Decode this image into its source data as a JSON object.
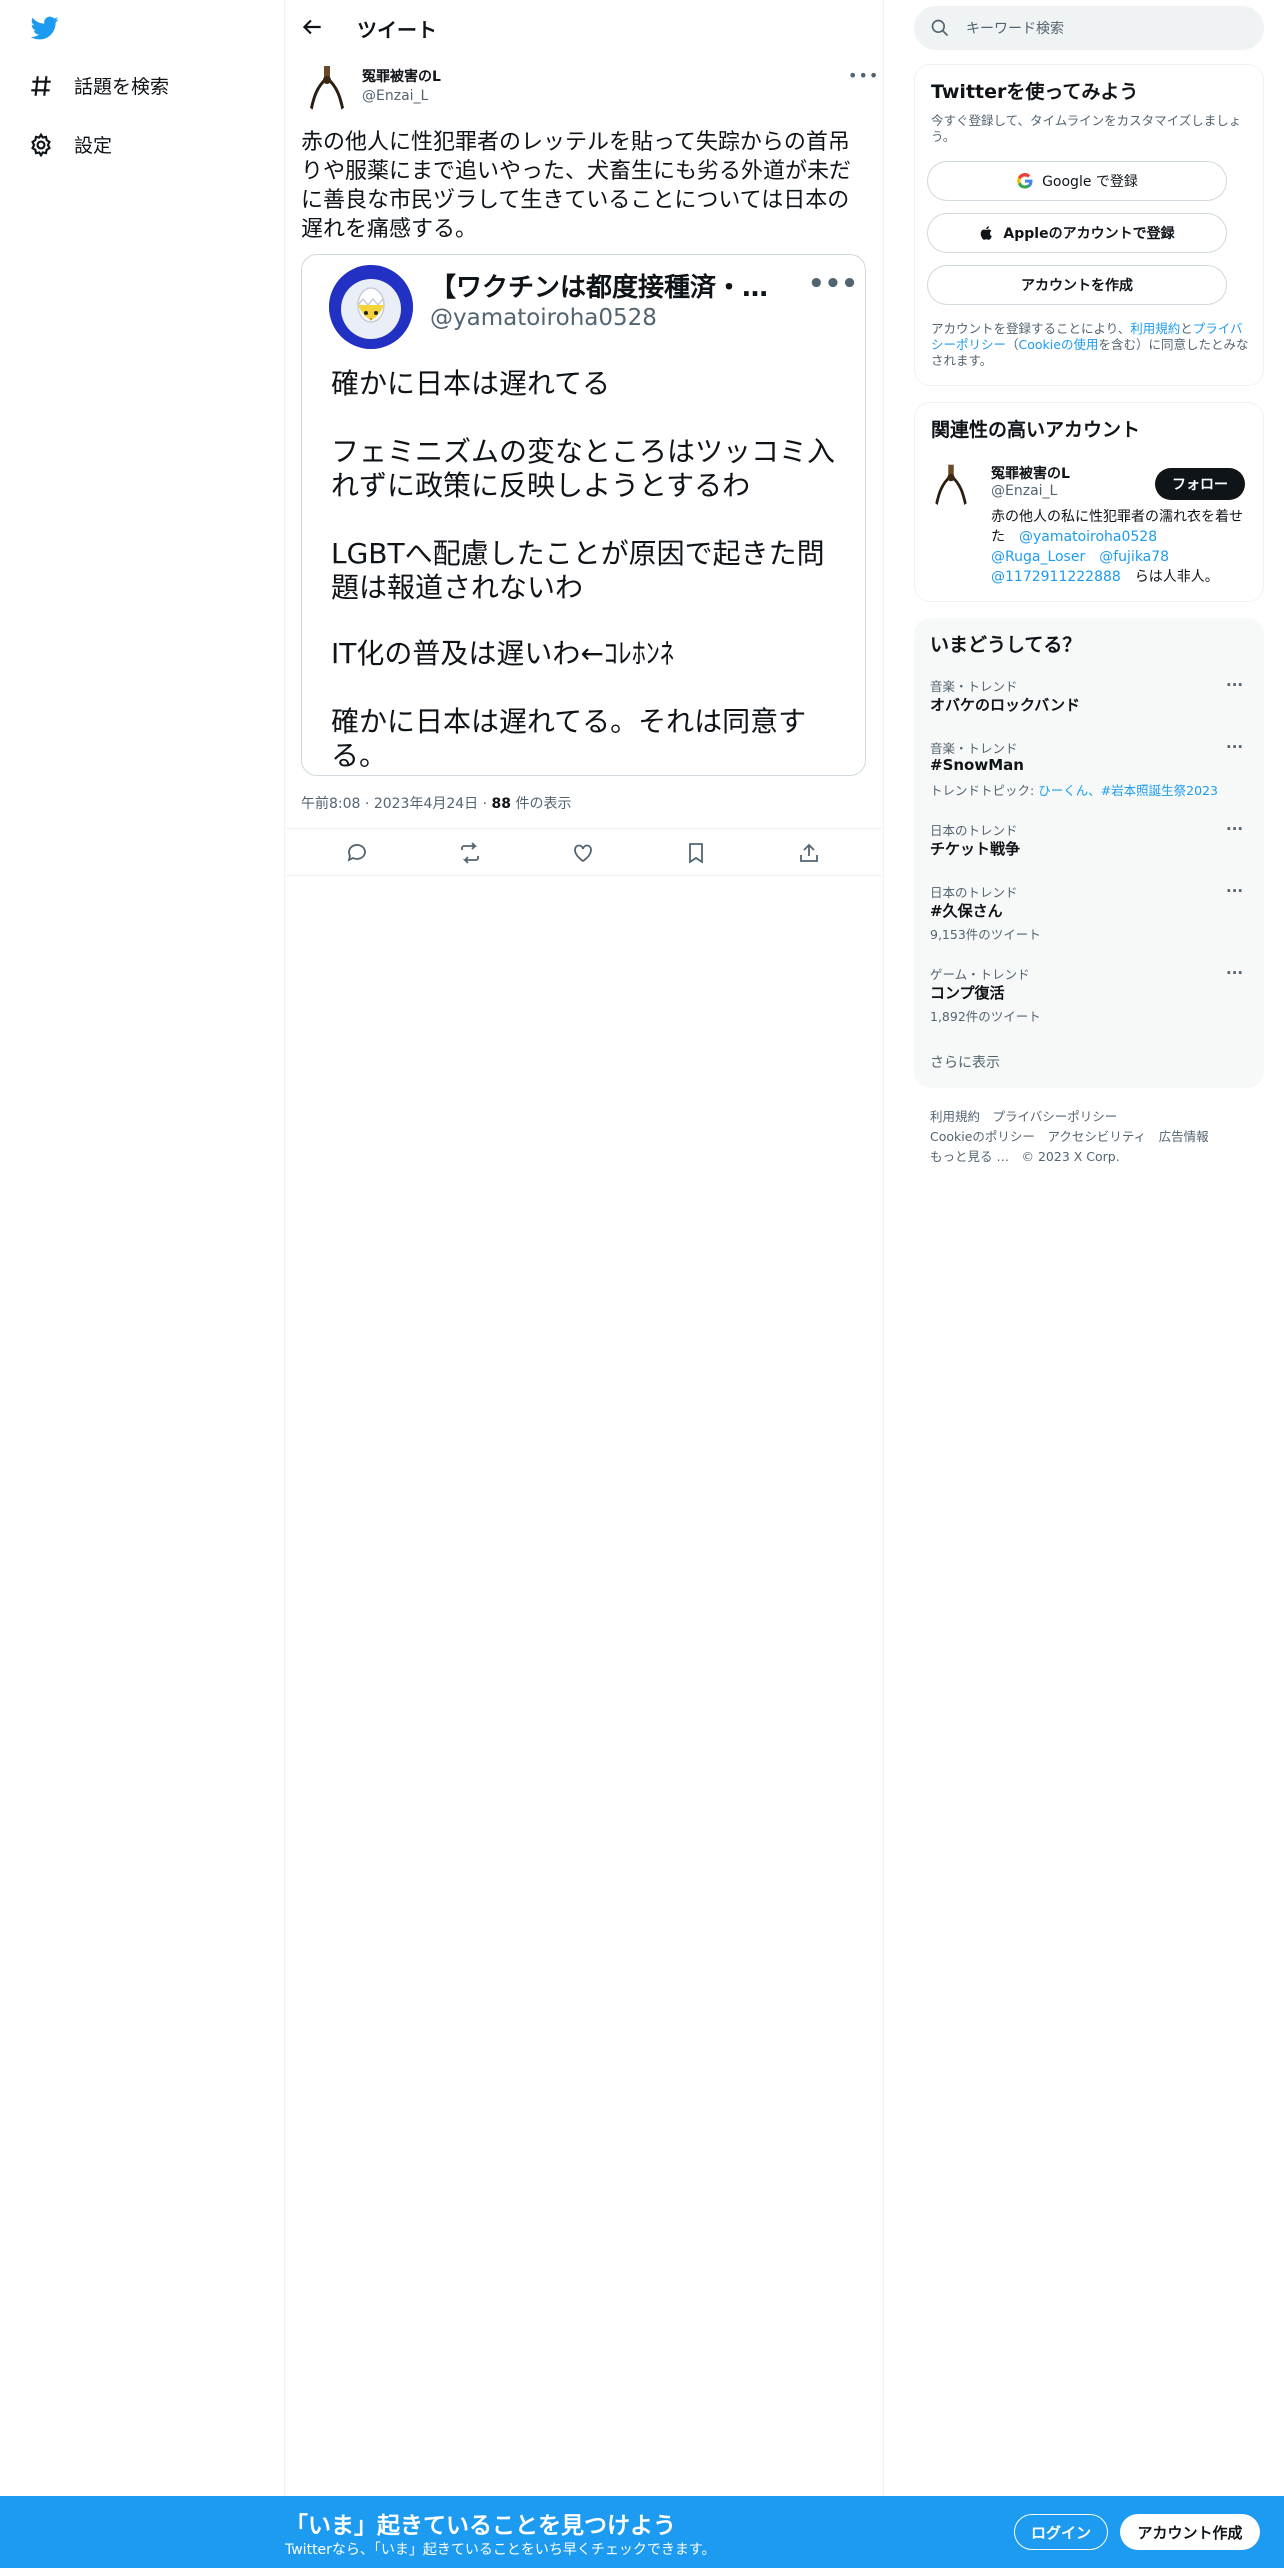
{
  "nav": {
    "explore_label": "話題を検索",
    "settings_label": "設定"
  },
  "header": {
    "title": "ツイート"
  },
  "tweet": {
    "author_name": "冤罪被害のL",
    "author_handle": "@Enzai_L",
    "text": "赤の他人に性犯罪者のレッテルを貼って失踪からの首吊りや服薬にまで追いやった、犬畜生にも劣る外道が未だに善良な市民ヅラして生きていることについては日本の遅れを痛感する。",
    "time": "午前8:08",
    "date": "2023年4月24日",
    "views_count": "88",
    "views_label": "件の表示"
  },
  "quote": {
    "name": "【ワクチンは都度接種済・油断禁物】",
    "handle": "@yamatoiroha0528",
    "lines": [
      "確かに日本は遅れてる",
      "フェミニズムの変なところはツッコミ入れずに政策に反映しようとするわ",
      "LGBTへ配慮したことが原因で起きた問題は報道されないわ",
      "IT化の普及は遅いわ←ｺﾚﾎﾝﾈ",
      "確かに日本は遅れてる。それは同意する。"
    ]
  },
  "search": {
    "placeholder": "キーワード検索"
  },
  "signup_card": {
    "title": "Twitterを使ってみよう",
    "subtitle": "今すぐ登録して、タイムラインをカスタマイズしましょう。",
    "google_label": "Google で登録",
    "apple_label": "Appleのアカウントで登録",
    "create_label": "アカウントを作成",
    "terms_prefix": "アカウントを登録することにより、",
    "terms_link": "利用規約",
    "terms_and": "と",
    "privacy_link": "プライバシーポリシー",
    "cookie_prefix": "（",
    "cookie_link": "Cookieの使用",
    "terms_suffix": "を含む）に同意したとみなされます。"
  },
  "related": {
    "title": "関連性の高いアカウント",
    "name": "冤罪被害のL",
    "handle": "@Enzai_L",
    "follow_label": "フォロー",
    "bio_1": "赤の他人の私に性犯罪者の濡れ衣を着せた",
    "bio_mention_1": "@yamatoiroha0528",
    "bio_mention_2": "@Ruga_Loser",
    "bio_mention_3": "@fujika78",
    "bio_mention_4": "@1172911222888",
    "bio_2": "らは人非人。"
  },
  "trends": {
    "title": "いまどうしてる？",
    "items": [
      {
        "category": "音楽・トレンド",
        "name": "オバケのロックバンド",
        "sub": ""
      },
      {
        "category": "音楽・トレンド",
        "name": "#SnowMan",
        "sub": "トレンドトピック: ",
        "topics": "ひーくん、#岩本照誕生祭2023"
      },
      {
        "category": "日本のトレンド",
        "name": "チケット戦争",
        "sub": ""
      },
      {
        "category": "日本のトレンド",
        "name": "#久保さん",
        "sub": "9,153件のツイート"
      },
      {
        "category": "ゲーム・トレンド",
        "name": "コンプ復活",
        "sub": "1,892件のツイート"
      }
    ],
    "show_more": "さらに表示"
  },
  "footer": {
    "line1": [
      "利用規約",
      "プライバシーポリシー"
    ],
    "line2": [
      "Cookieのポリシー",
      "アクセシビリティ",
      "広告情報"
    ],
    "line3": [
      "もっと見る …",
      "© 2023 X Corp."
    ]
  },
  "bottom_bar": {
    "title": "「いま」起きていることを見つけよう",
    "subtitle": "Twitterなら、「いま」起きていることをいち早くチェックできます。",
    "login_label": "ログイン",
    "signup_label": "アカウント作成"
  },
  "colors": {
    "accent": "#1d9bf0",
    "text": "#0f1419",
    "secondary": "#536471",
    "border": "#eff3f4"
  }
}
